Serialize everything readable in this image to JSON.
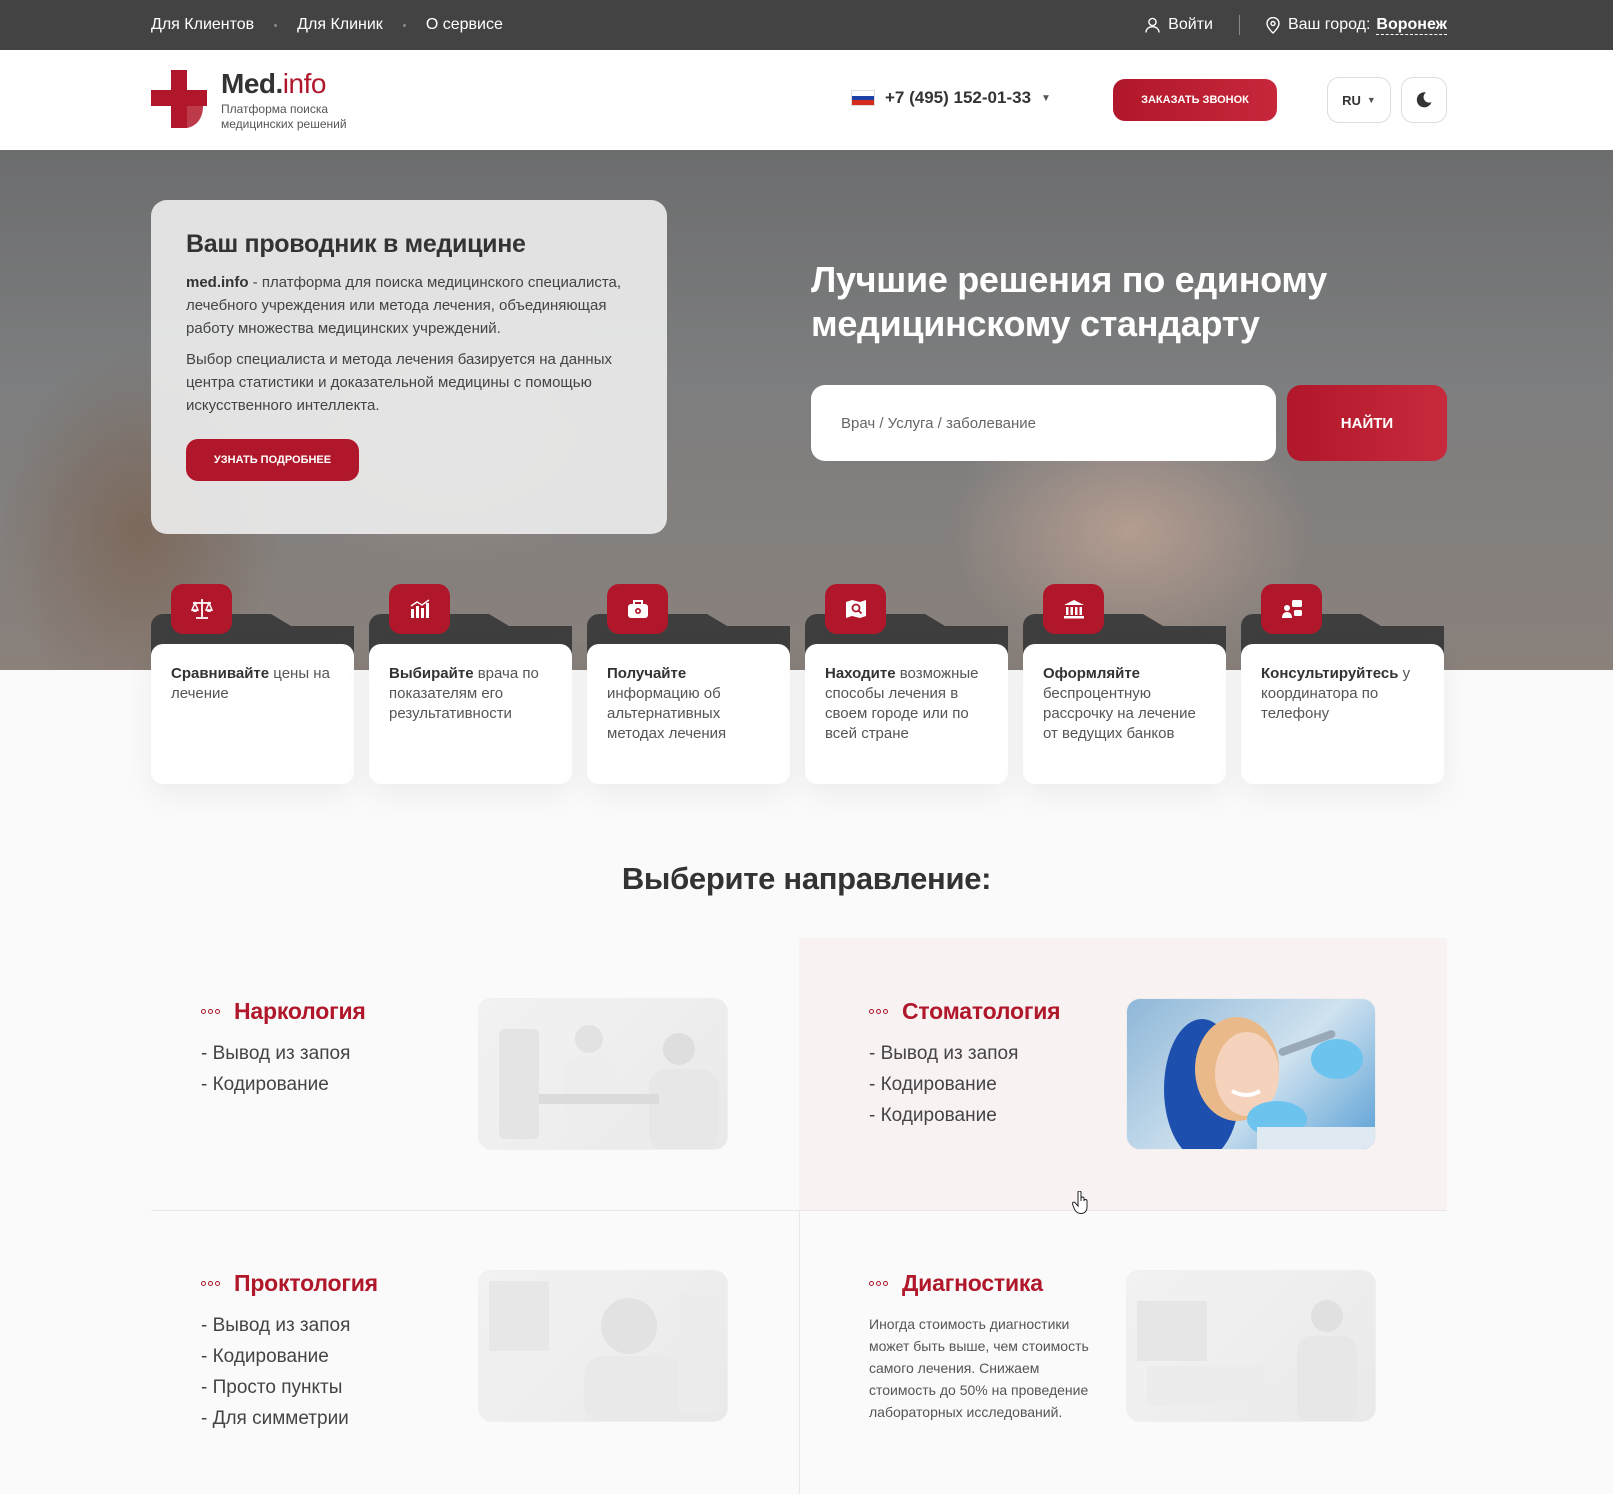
{
  "topbar": {
    "links": [
      "Для Клиентов",
      "Для Клиник",
      "О сервисе"
    ],
    "login": "Войти",
    "city_label": "Ваш город:",
    "city_value": "Воронеж"
  },
  "header": {
    "logo_name": "Med.",
    "logo_suffix": "info",
    "logo_sub": "Платформа поиска медицинских решений",
    "phone": "+7 (495) 152-01-33",
    "call_button": "ЗАКАЗАТЬ ЗВОНОК",
    "lang": "RU"
  },
  "hero": {
    "card_title": "Ваш проводник в медицине",
    "card_brand": "med.info",
    "card_p1": " - платформа для поиска медицинского специалиста, лечебного учреждения или метода лечения, объединяющая работу множества медицинских учреждений.",
    "card_p2": "Выбор специалиста и метода лечения базируется на данных центра статистики и доказательной медицины с помощью искусственного интеллекта.",
    "card_button": "УЗНАТЬ ПОДРОБНЕЕ",
    "title": "Лучшие решения по единому медицинскому стандарту",
    "search_placeholder": "Врач / Услуга / заболевание",
    "search_button": "НАЙТИ"
  },
  "features": [
    {
      "bold": "Сравнивайте",
      "text": " цены на лечение",
      "icon": "scales-icon"
    },
    {
      "bold": "Выбирайте",
      "text": " врача по показателям его результативности",
      "icon": "chart-icon"
    },
    {
      "bold": "Получайте",
      "text": " информацию об альтернативных методах лечения",
      "icon": "medkit-icon"
    },
    {
      "bold": "Находите",
      "text": " возможные способы лечения в своем городе или по всей стране",
      "icon": "map-search-icon"
    },
    {
      "bold": "Оформляйте",
      "text": " беспроцентную рассрочку на лечение от ведущих банков",
      "icon": "bank-icon"
    },
    {
      "bold": "Консультируйтесь",
      "text": " у координатора по телефону",
      "icon": "consult-icon"
    }
  ],
  "section": {
    "title": "Выберите направление:",
    "directions": [
      {
        "title": "Наркология",
        "items": [
          "- Вывод из запоя",
          "- Кодирование"
        ]
      },
      {
        "title": "Стоматология",
        "items": [
          "- Вывод из запоя",
          "- Кодирование",
          "- Кодирование"
        ]
      },
      {
        "title": "Проктология",
        "items": [
          "- Вывод из запоя",
          "- Кодирование",
          "- Просто пункты",
          "- Для симметрии"
        ]
      },
      {
        "title": "Диагностика",
        "text": "Иногда стоимость диагностики может быть выше, чем стоимость самого лечения. Снижаем стоимость до 50% на проведение лабораторных исследований."
      }
    ]
  },
  "colors": {
    "accent": "#b0172a",
    "topbar": "#434343"
  }
}
